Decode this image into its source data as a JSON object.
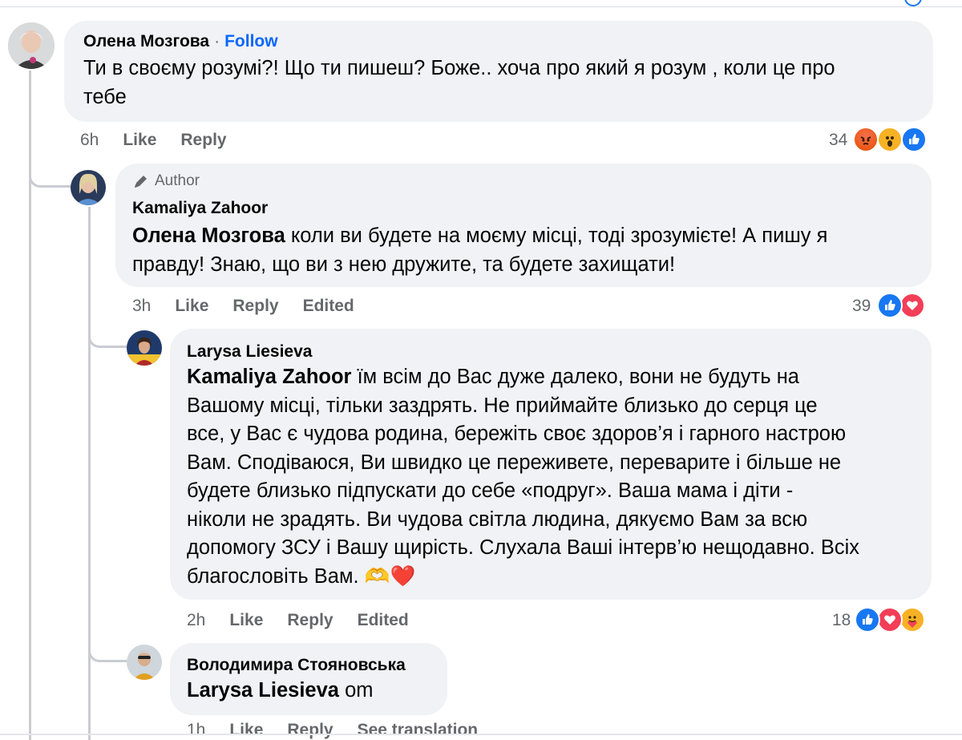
{
  "comments": [
    {
      "author": "Олена Мозгова",
      "follow_label": "Follow",
      "separator": "·",
      "text": "Ти в своєму розумі?! Що ти пишеш? Боже.. хоча про який я розум , коли це про тебе",
      "text_line1": "Ти в своєму розумі?! Що ти пишеш? Боже.. хоча про який я розум , коли це про",
      "text_line2": "тебе",
      "time": "6h",
      "like_label": "Like",
      "reply_label": "Reply",
      "reaction_count": "34",
      "reactions": [
        "angry",
        "wow",
        "like"
      ]
    },
    {
      "badge": "Author",
      "author": "Kamaliya Zahoor",
      "mention": "Олена Мозгова",
      "text_line1": "коли ви будете на моєму місці, тоді зрозумієте! А пишу я",
      "text_line2": "правду! Знаю, що ви з нею дружите, та будете захищати!",
      "time": "3h",
      "like_label": "Like",
      "reply_label": "Reply",
      "edited_label": "Edited",
      "reaction_count": "39",
      "reactions": [
        "like",
        "love"
      ]
    },
    {
      "author": "Larysa Liesieva",
      "mention": "Kamaliya Zahoor",
      "lines": [
        "їм всім до Вас дуже далеко, вони не будуть на",
        "Вашому місці, тільки заздрять. Не приймайте близько до серця це",
        "все, у Вас є чудова родина, бережіть своє здоров’я і гарного настрою",
        "Вам. Сподіваюся, Ви швидко це переживете, переварите і більше не",
        "будете близько підпускати до себе «подруг». Ваша мама і діти -",
        "ніколи не зрадять. Ви чудова світла людина, дякуємо Вам за всю",
        "допомогу ЗСУ і Вашу щирість. Слухала Ваші інтерв’ю нещодавно. Всіх",
        "благословіть Вам."
      ],
      "emoji": "🫶❤️",
      "time": "2h",
      "like_label": "Like",
      "reply_label": "Reply",
      "edited_label": "Edited",
      "reaction_count": "18",
      "reactions": [
        "like",
        "love",
        "care"
      ]
    },
    {
      "author": "Володимира Стояновська",
      "mention": "Larysa Liesieva",
      "text": "om",
      "time": "1h",
      "like_label": "Like",
      "reply_label": "Reply",
      "translation_label": "See translation"
    }
  ],
  "colors": {
    "bubble": "#f0f2f5",
    "link": "#0866ff",
    "meta": "#65676b",
    "thread": "#c9ccd1"
  },
  "icons": [
    "pen-icon",
    "like-reaction-icon",
    "love-reaction-icon",
    "angry-reaction-icon",
    "wow-reaction-icon",
    "care-reaction-icon"
  ]
}
